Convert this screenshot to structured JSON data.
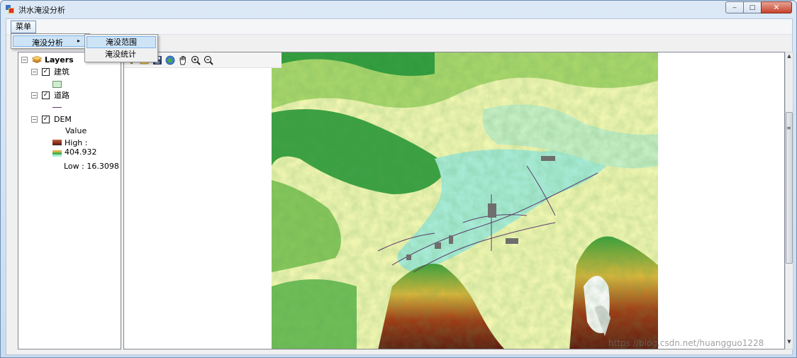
{
  "window": {
    "title": "洪水淹没分析",
    "controls": {
      "minimize": "‒",
      "maximize": "□",
      "close": "✕"
    }
  },
  "menu": {
    "top_label": "菜单",
    "submenu": {
      "label": "淹没分析",
      "arrow": "▸"
    },
    "items": [
      {
        "label": "淹没范围"
      },
      {
        "label": "淹没统计"
      }
    ]
  },
  "toc": {
    "root": "Layers",
    "layers": [
      {
        "name": "建筑",
        "checked": "✓",
        "symbol_color": "#cfeed0"
      },
      {
        "name": "道路",
        "checked": "✓",
        "symbol_color": "#5a3b6a"
      },
      {
        "name": "DEM",
        "checked": "✓"
      }
    ],
    "dem_legend": {
      "field": "Value",
      "high": "High : 404.932",
      "low": "Low : 16.3098",
      "high_color": "#7a1b10",
      "low_color": "#47b247"
    }
  },
  "toolbar": {
    "icons": [
      "identify-icon",
      "open-file-icon",
      "save-icon",
      "full-extent-icon",
      "pan-icon",
      "zoom-in-icon",
      "zoom-out-icon"
    ]
  },
  "map": {
    "colors": {
      "water": "#a8ecd8",
      "lowland": "#f3f7b6",
      "forest": "#2e9b35",
      "mountain": "#7a1b10",
      "roads": "#5a3b6a"
    }
  },
  "watermark": "https://blog.csdn.net/huangguo1228"
}
